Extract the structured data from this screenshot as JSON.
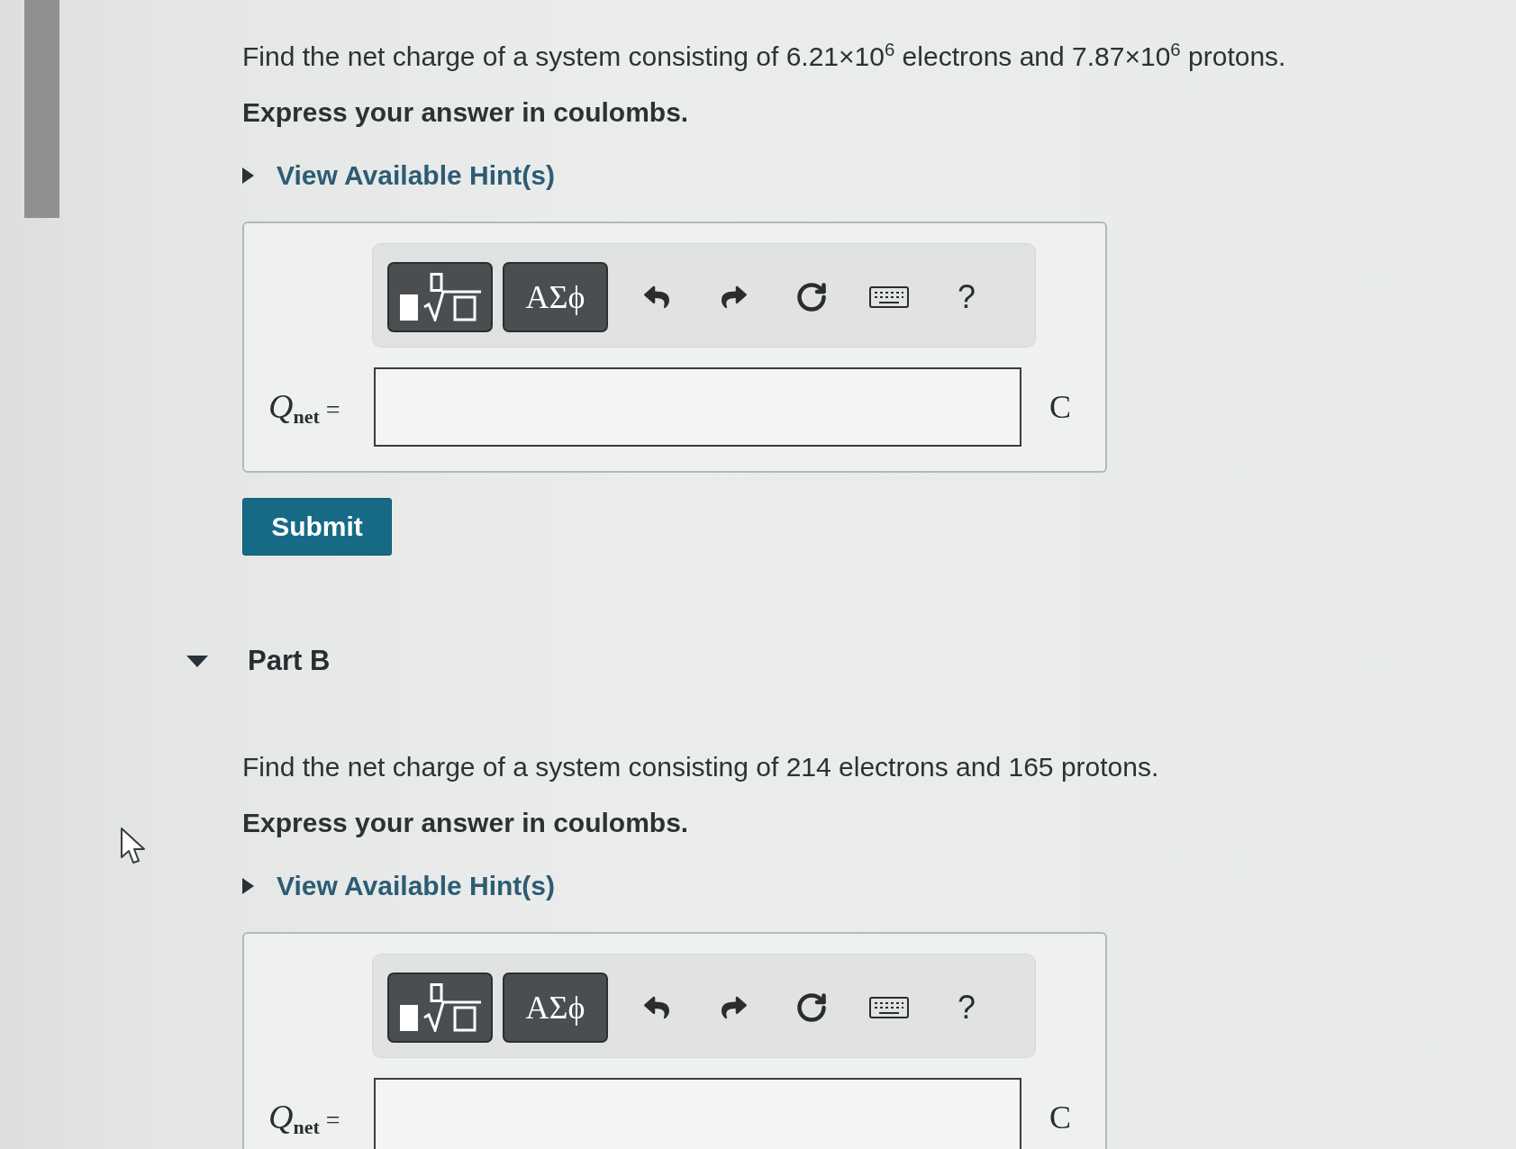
{
  "parts": [
    {
      "question": "Find the net charge of a system consisting of 6.21×10$^{6}$ electrons and 7.87×10$^{6}$ protons.",
      "instruction": "Express your answer in coulombs.",
      "hint": {
        "label": "View Available Hint(s)",
        "expanded": false
      },
      "answer": {
        "toolbar": [
          {
            "kind": "templates"
          },
          {
            "kind": "symbols",
            "label": "ΑΣϕ"
          },
          {
            "kind": "undo"
          },
          {
            "kind": "redo"
          },
          {
            "kind": "reset"
          },
          {
            "kind": "keyboard"
          },
          {
            "kind": "help",
            "label": "?"
          }
        ],
        "variable": "*Q*$_{net}$ =",
        "unit": "C"
      },
      "submit": "Submit"
    },
    {
      "title": "Part B",
      "expanded": true,
      "question": "Find the net charge of a system consisting of 214 electrons and 165 protons.",
      "instruction": "Express your answer in coulombs.",
      "hint": {
        "label": "View Available Hint(s)",
        "expanded": false
      },
      "answer": {
        "toolbar": [
          {
            "kind": "templates"
          },
          {
            "kind": "symbols",
            "label": "ΑΣϕ"
          },
          {
            "kind": "undo"
          },
          {
            "kind": "redo"
          },
          {
            "kind": "reset"
          },
          {
            "kind": "keyboard"
          },
          {
            "kind": "help",
            "label": "?"
          }
        ],
        "variable": "*Q*$_{net}$ =",
        "unit": "C"
      }
    }
  ]
}
